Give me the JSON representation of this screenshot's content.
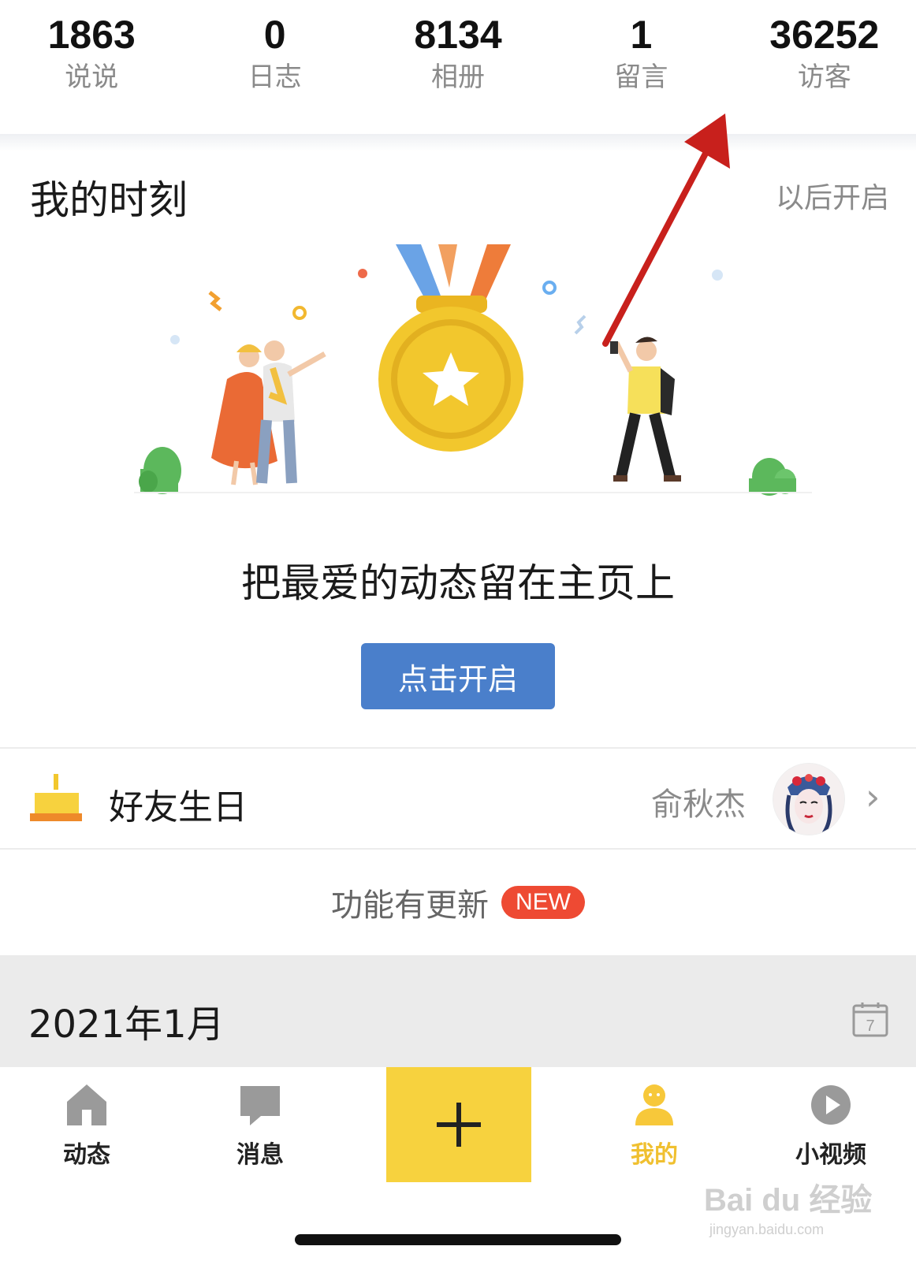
{
  "stats": [
    {
      "value": "1863",
      "label": "说说"
    },
    {
      "value": "0",
      "label": "日志"
    },
    {
      "value": "8134",
      "label": "相册"
    },
    {
      "value": "1",
      "label": "留言"
    },
    {
      "value": "36252",
      "label": "访客"
    }
  ],
  "moments": {
    "title": "我的时刻",
    "later": "以后开启",
    "headline": "把最爱的动态留在主页上",
    "button": "点击开启"
  },
  "birthday": {
    "label": "好友生日",
    "friend": "俞秋杰",
    "icon": "cake-icon"
  },
  "update": {
    "text": "功能有更新",
    "badge": "NEW"
  },
  "month": {
    "text": "2021年1月",
    "calendar_day": "7"
  },
  "tabs": [
    {
      "label": "动态",
      "icon": "home-icon",
      "active": false
    },
    {
      "label": "消息",
      "icon": "message-icon",
      "active": false
    },
    {
      "label": "我的",
      "icon": "profile-icon",
      "active": true
    },
    {
      "label": "小视频",
      "icon": "video-icon",
      "active": false
    }
  ],
  "colors": {
    "accent_yellow": "#f7d23e",
    "button_blue": "#4a7fcb",
    "badge_red": "#ee4a33",
    "arrow_red": "#c8201c"
  },
  "watermark": {
    "brand": "Bai du 经验",
    "url": "jingyan.baidu.com"
  }
}
